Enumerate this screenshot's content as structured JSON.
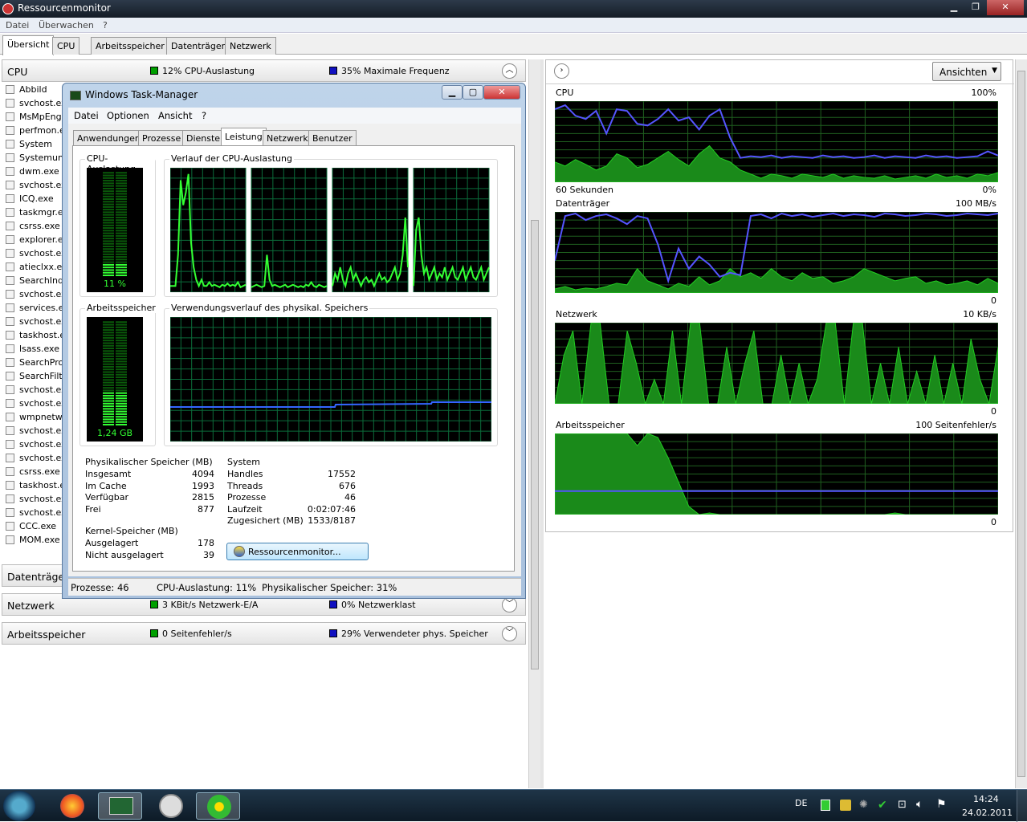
{
  "window": {
    "title": "Ressourcenmonitor"
  },
  "menu": [
    "Datei",
    "Überwachen",
    "?"
  ],
  "tabs": [
    "Übersicht",
    "CPU",
    "Arbeitsspeicher",
    "Datenträger",
    "Netzwerk"
  ],
  "cpu_section": {
    "label": "CPU",
    "metric1": "12% CPU-Auslastung",
    "metric2": "35% Maximale Frequenz",
    "color1": "#00a000",
    "color2": "#1010c0"
  },
  "process_header": "Abbild",
  "processes": [
    "svchost.exe",
    "MsMpEng.exe",
    "perfmon.exe",
    "System",
    "Systemunterbrechungen",
    "dwm.exe",
    "svchost.exe",
    "ICQ.exe",
    "taskmgr.exe",
    "csrss.exe",
    "explorer.exe",
    "svchost.exe",
    "atieclxx.exe",
    "SearchIndexer.exe",
    "svchost.exe",
    "services.exe",
    "svchost.exe",
    "taskhost.exe",
    "lsass.exe",
    "SearchProtocolHost.exe",
    "SearchFilterHost.exe",
    "svchost.exe",
    "svchost.exe",
    "wmpnetwk.exe",
    "svchost.exe",
    "svchost.exe",
    "svchost.exe",
    "csrss.exe",
    "taskhost.exe",
    "svchost.exe",
    "svchost.exe",
    "CCC.exe",
    "MOM.exe"
  ],
  "disk_section": {
    "label": "Datenträger"
  },
  "net_section": {
    "label": "Netzwerk",
    "metric1": "3 KBit/s Netzwerk-E/A",
    "metric2": "0% Netzwerklast"
  },
  "mem_section": {
    "label": "Arbeitsspeicher",
    "metric1": "0 Seitenfehler/s",
    "metric2": "29% Verwendeter phys. Speicher"
  },
  "right": {
    "views_button": "Ansichten",
    "graphs": [
      {
        "title": "CPU",
        "max": "100%",
        "left_bottom": "60 Sekunden",
        "min": "0%"
      },
      {
        "title": "Datenträger",
        "max": "100 MB/s",
        "left_bottom": "",
        "min": "0"
      },
      {
        "title": "Netzwerk",
        "max": "10 KB/s",
        "left_bottom": "",
        "min": "0"
      },
      {
        "title": "Arbeitsspeicher",
        "max": "100 Seitenfehler/s",
        "left_bottom": "",
        "min": "0"
      }
    ]
  },
  "taskmgr": {
    "title": "Windows Task-Manager",
    "menu": [
      "Datei",
      "Optionen",
      "Ansicht",
      "?"
    ],
    "tabs": [
      "Anwendungen",
      "Prozesse",
      "Dienste",
      "Leistung",
      "Netzwerk",
      "Benutzer"
    ],
    "cpu_usage_label": "CPU-Auslastung",
    "cpu_usage_value": "11 %",
    "cpu_history_label": "Verlauf der CPU-Auslastung",
    "mem_label": "Arbeitsspeicher",
    "mem_value": "1,24 GB",
    "mem_history_label": "Verwendungsverlauf des physikal. Speichers",
    "phys": {
      "title": "Physikalischer Speicher (MB)",
      "rows": [
        [
          "Insgesamt",
          "4094"
        ],
        [
          "Im Cache",
          "1993"
        ],
        [
          "Verfügbar",
          "2815"
        ],
        [
          "Frei",
          "877"
        ]
      ]
    },
    "kernel": {
      "title": "Kernel-Speicher (MB)",
      "rows": [
        [
          "Ausgelagert",
          "178"
        ],
        [
          "Nicht ausgelagert",
          "39"
        ]
      ]
    },
    "system": {
      "title": "System",
      "rows": [
        [
          "Handles",
          "17552"
        ],
        [
          "Threads",
          "676"
        ],
        [
          "Prozesse",
          "46"
        ],
        [
          "Laufzeit",
          "0:02:07:46"
        ],
        [
          "Zugesichert (MB)",
          "1533/8187"
        ]
      ]
    },
    "resmon_button": "Ressourcenmonitor...",
    "status": {
      "processes": "Prozesse: 46",
      "cpu": "CPU-Auslastung: 11%",
      "mem": "Physikalischer Speicher: 31%"
    }
  },
  "taskbar": {
    "lang": "DE",
    "time": "14:24",
    "date": "24.02.2011"
  }
}
